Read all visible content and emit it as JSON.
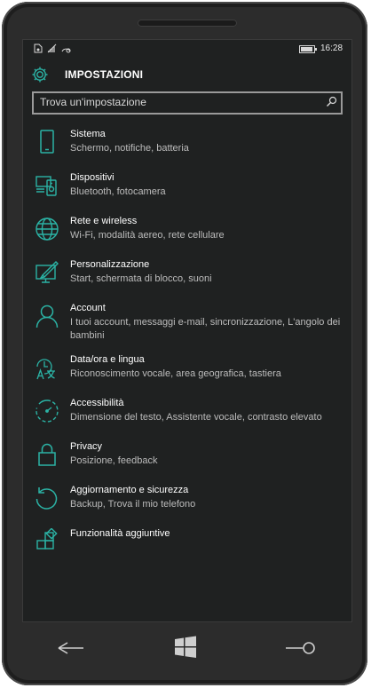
{
  "status": {
    "time": "16:28"
  },
  "header": {
    "title": "IMPOSTAZIONI",
    "icon": "gear-icon"
  },
  "search": {
    "placeholder": "Trova un'impostazione"
  },
  "accent": "#2bb3a5",
  "items": [
    {
      "label": "Sistema",
      "desc": "Schermo, notifiche, batteria",
      "icon": "phone-icon"
    },
    {
      "label": "Dispositivi",
      "desc": "Bluetooth, fotocamera",
      "icon": "devices-icon"
    },
    {
      "label": "Rete e wireless",
      "desc": "Wi-Fi, modalità aereo, rete cellulare",
      "icon": "globe-icon"
    },
    {
      "label": "Personalizzazione",
      "desc": "Start, schermata di blocco, suoni",
      "icon": "paint-icon"
    },
    {
      "label": "Account",
      "desc": "I tuoi account, messaggi e-mail, sincronizzazione, L'angolo dei bambini",
      "icon": "person-icon"
    },
    {
      "label": "Data/ora e lingua",
      "desc": "Riconoscimento vocale, area geografica, tastiera",
      "icon": "time-language-icon"
    },
    {
      "label": "Accessibilità",
      "desc": "Dimensione del testo, Assistente vocale, contrasto elevato",
      "icon": "accessibility-icon"
    },
    {
      "label": "Privacy",
      "desc": "Posizione, feedback",
      "icon": "lock-icon"
    },
    {
      "label": "Aggiornamento e sicurezza",
      "desc": "Backup, Trova il mio telefono",
      "icon": "sync-icon"
    },
    {
      "label": "Funzionalità aggiuntive",
      "desc": "",
      "icon": "extras-icon"
    }
  ]
}
